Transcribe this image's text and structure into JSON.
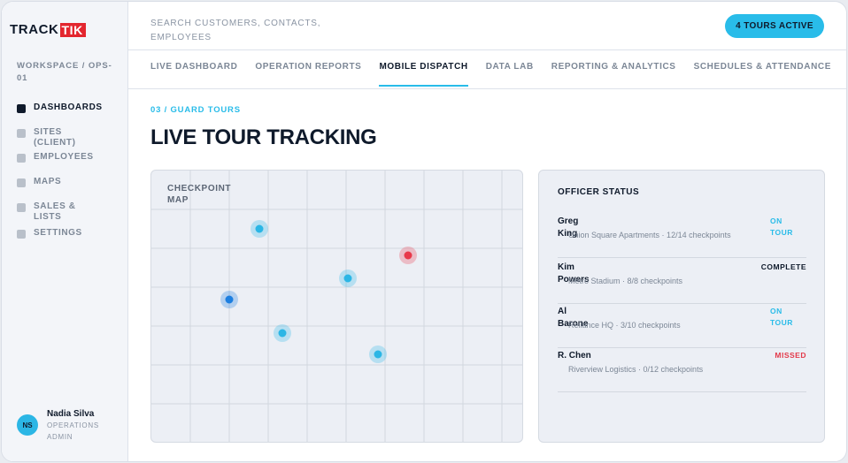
{
  "brand": {
    "logo_part1": "TRACK",
    "logo_part2": "TIK",
    "accent": "#29bce9",
    "brand_red": "#e3262f"
  },
  "sidebar": {
    "workspace": "WORKSPACE / OPS-01",
    "items": [
      {
        "label": "DASHBOARDS",
        "active": true
      },
      {
        "label": "SITES (CLIENT)",
        "active": false
      },
      {
        "label": "EMPLOYEES",
        "active": false
      },
      {
        "label": "MAPS",
        "active": false
      },
      {
        "label": "SALES & LISTS",
        "active": false
      },
      {
        "label": "SETTINGS",
        "active": false
      }
    ],
    "user": {
      "initials": "NS",
      "name": "Nadia Silva",
      "role": "OPERATIONS ADMIN"
    }
  },
  "header": {
    "search_placeholder": "SEARCH CUSTOMERS, CONTACTS, EMPLOYEES",
    "tours_button": "4 TOURS ACTIVE"
  },
  "tabs": [
    {
      "label": "LIVE DASHBOARD",
      "active": false
    },
    {
      "label": "OPERATION REPORTS",
      "active": false
    },
    {
      "label": "MOBILE DISPATCH",
      "active": true
    },
    {
      "label": "DATA LAB",
      "active": false
    },
    {
      "label": "REPORTING & ANALYTICS",
      "active": false
    },
    {
      "label": "SCHEDULES & ATTENDANCE",
      "active": false
    }
  ],
  "main": {
    "eyebrow": "03 / GUARD TOURS",
    "title": "LIVE TOUR TRACKING",
    "map_label": "CHECKPOINT MAP",
    "status_title": "OFFICER STATUS",
    "officers": [
      {
        "name": "Greg King",
        "detail": "Union Square Apartments · 12/14 checkpoints",
        "status": "ON TOUR",
        "status_kind": "on"
      },
      {
        "name": "Kim Powers",
        "detail": "Metro Stadium · 8/8 checkpoints",
        "status": "COMPLETE",
        "status_kind": "complete"
      },
      {
        "name": "Al Barone",
        "detail": "Reliance HQ · 3/10 checkpoints",
        "status": "ON TOUR",
        "status_kind": "on"
      },
      {
        "name": "R. Chen",
        "detail": "Riverview Logistics · 0/12 checkpoints",
        "status": "MISSED",
        "status_kind": "missed"
      }
    ],
    "checkpoint_colors": {
      "light": "#2bb6e5",
      "dark": "#1d7fe0",
      "alert": "#e8394a"
    }
  }
}
